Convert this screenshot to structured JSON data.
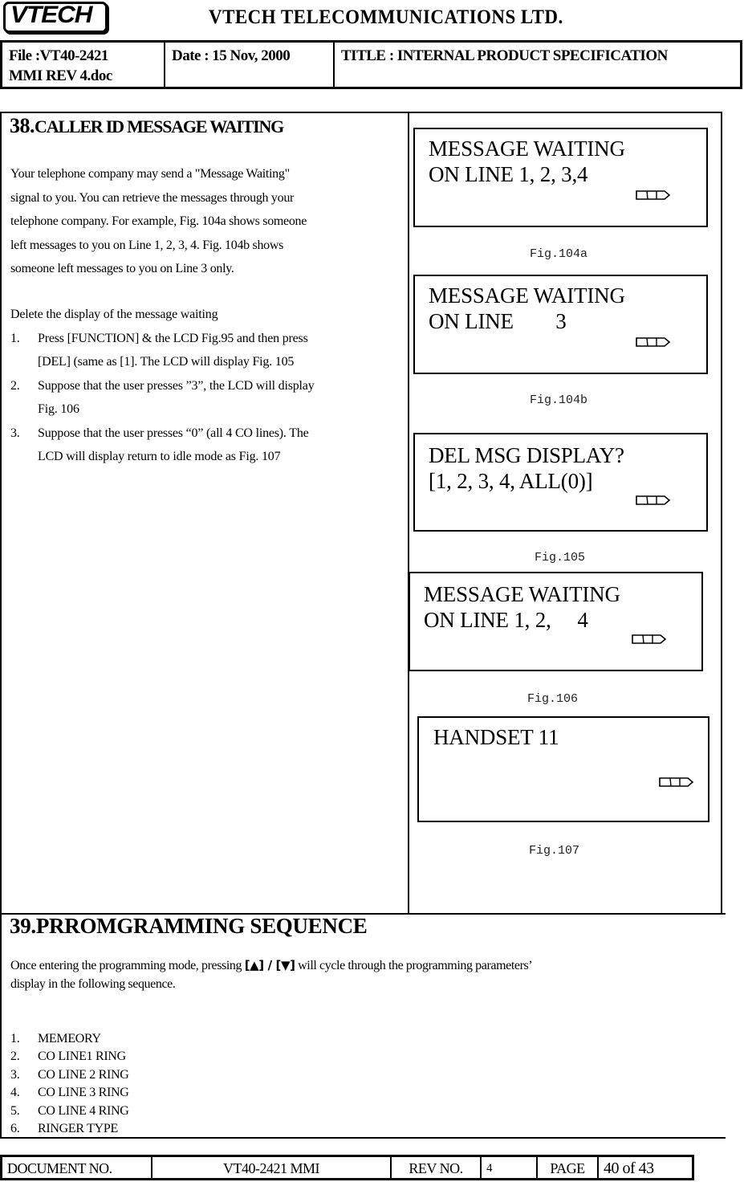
{
  "header": {
    "logo_text": "VTECH",
    "company": "VTECH  TELECOMMUNICATIONS  LTD.",
    "file_line1": "File :VT40-2421",
    "file_line2": "MMI REV 4.doc",
    "date": "Date :  15 Nov, 2000",
    "title": "TITLE : INTERNAL PRODUCT SPECIFICATION"
  },
  "section38": {
    "number": "38.",
    "title": "CALLER ID MESSAGE WAITING",
    "paragraph_lines": [
      "Your telephone company may send a \"Message Waiting\"",
      "signal to you. You can retrieve the messages through your",
      "telephone company. For example, Fig. 104a  shows someone",
      "left messages to you on Line 1, 2, 3, 4. Fig. 104b shows",
      "someone left messages to you on Line 3 only."
    ],
    "delete_heading": "Delete the display of the message waiting",
    "steps": [
      {
        "num": "1.",
        "lines": [
          "Press [FUNCTION] & the LCD Fig.95 and then press",
          "[DEL] (same as [1]. The LCD will display Fig. 105"
        ]
      },
      {
        "num": "2.",
        "lines": [
          "Suppose that the user presses ”3”, the LCD will display",
          "Fig. 106"
        ]
      },
      {
        "num": "3.",
        "lines": [
          "Suppose that the user presses “0” (all 4 CO lines).  The",
          "LCD will display return to idle mode as Fig. 107"
        ]
      }
    ],
    "figures": [
      {
        "id": "fig104a",
        "line1": "MESSAGE WAITING",
        "line2": "ON LINE 1, 2, 3,4",
        "caption": "Fig.104a",
        "icon": "battery-icon"
      },
      {
        "id": "fig104b",
        "line1": "MESSAGE WAITING",
        "line2": "ON LINE        3",
        "caption": "Fig.104b",
        "icon": "battery-icon"
      },
      {
        "id": "fig105",
        "line1": "DEL MSG DISPLAY?",
        "line2": "[1, 2, 3, 4, ALL(0)]",
        "caption": "Fig.105",
        "icon": "battery-icon"
      },
      {
        "id": "fig106",
        "line1": "MESSAGE WAITING",
        "line2": "ON LINE 1, 2,     4",
        "caption": "Fig.106",
        "icon": "battery-icon"
      },
      {
        "id": "fig107",
        "line1": "HANDSET 11",
        "line2": "",
        "caption": "Fig.107",
        "icon": "battery-icon"
      }
    ]
  },
  "section39": {
    "title": "39.PRROMGRAMMING SEQUENCE",
    "intro_before": "Once entering the programming mode, pressing ",
    "key_up": "[▲]",
    "key_sep": " / ",
    "key_down": "[▼]",
    "intro_after": " will cycle through the programming parameters’",
    "intro_line2": "display in the following sequence.",
    "items": [
      {
        "num": "1.",
        "label": "MEMEORY"
      },
      {
        "num": "2.",
        "label": "CO LINE1 RING"
      },
      {
        "num": "3.",
        "label": "CO LINE 2 RING"
      },
      {
        "num": "4.",
        "label": "CO LINE 3 RING"
      },
      {
        "num": "5.",
        "label": "CO LINE 4 RING"
      },
      {
        "num": "6.",
        "label": "RINGER TYPE"
      }
    ]
  },
  "footer": {
    "doc_label": "DOCUMENT NO.",
    "doc_value": "VT40-2421 MMI",
    "rev_label": "REV NO.",
    "rev_value": "4",
    "page_label": "PAGE",
    "page_value": "40 of 43"
  }
}
